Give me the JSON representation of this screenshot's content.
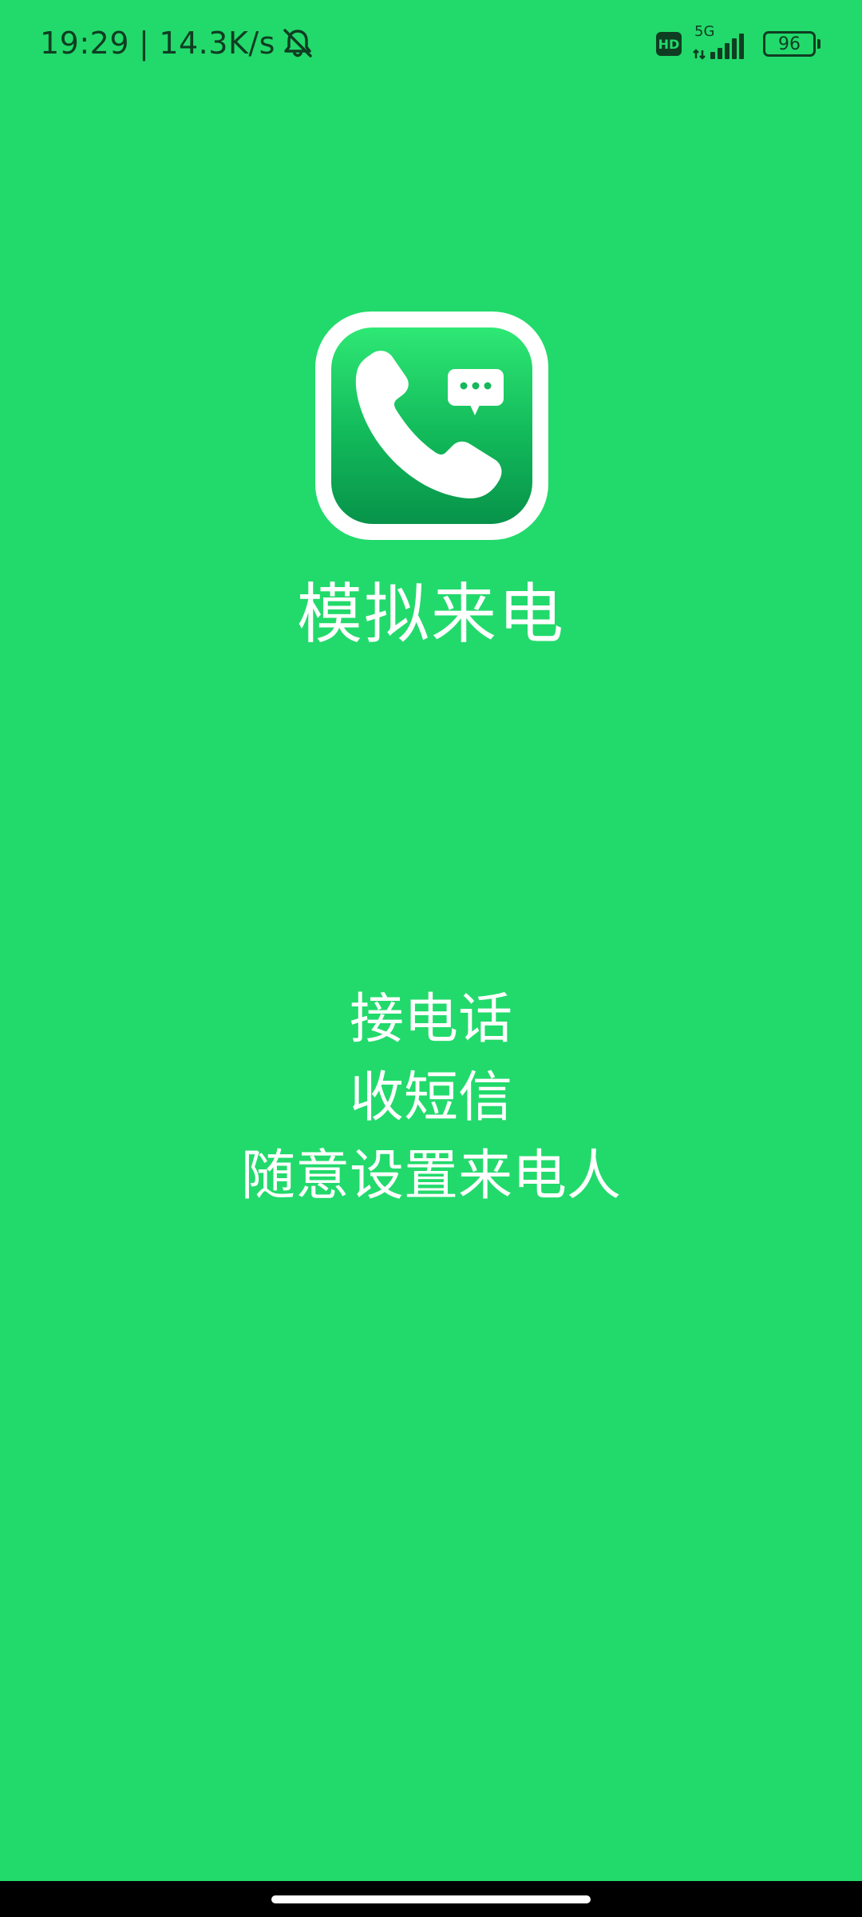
{
  "status_bar": {
    "time": "19:29",
    "separator": "|",
    "net_speed": "14.3K/s",
    "hd_label": "HD",
    "network_type": "5G",
    "battery_level": "96"
  },
  "app": {
    "name": "模拟来电"
  },
  "features": [
    "接电话",
    "收短信",
    "随意设置来电人"
  ],
  "colors": {
    "background": "#22da6b",
    "text": "#ffffff",
    "status_text": "#0f3d22"
  }
}
